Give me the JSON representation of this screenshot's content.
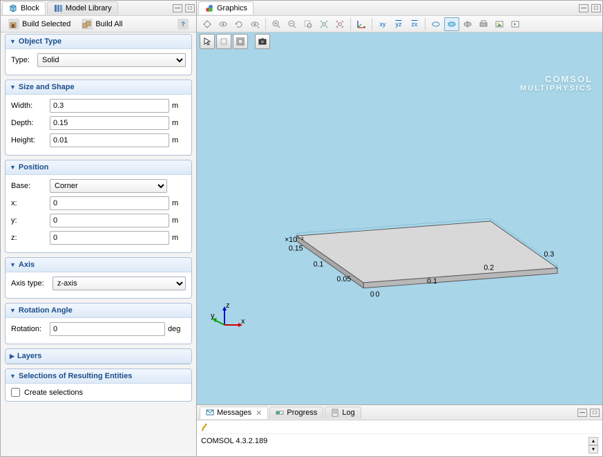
{
  "tabs": {
    "block": "Block",
    "model_library": "Model Library",
    "graphics": "Graphics"
  },
  "toolbar": {
    "build_selected": "Build Selected",
    "build_all": "Build All"
  },
  "sections": {
    "object_type": {
      "title": "Object Type",
      "type_label": "Type:",
      "type_value": "Solid"
    },
    "size_shape": {
      "title": "Size and Shape",
      "width_label": "Width:",
      "width_value": "0.3",
      "width_unit": "m",
      "depth_label": "Depth:",
      "depth_value": "0.15",
      "depth_unit": "m",
      "height_label": "Height:",
      "height_value": "0.01",
      "height_unit": "m"
    },
    "position": {
      "title": "Position",
      "base_label": "Base:",
      "base_value": "Corner",
      "x_label": "x:",
      "x_value": "0",
      "x_unit": "m",
      "y_label": "y:",
      "y_value": "0",
      "y_unit": "m",
      "z_label": "z:",
      "z_value": "0",
      "z_unit": "m"
    },
    "axis": {
      "title": "Axis",
      "axis_type_label": "Axis type:",
      "axis_type_value": "z-axis"
    },
    "rotation": {
      "title": "Rotation Angle",
      "rotation_label": "Rotation:",
      "rotation_value": "0",
      "rotation_unit": "deg"
    },
    "layers": {
      "title": "Layers"
    },
    "selections": {
      "title": "Selections of Resulting Entities",
      "create_label": "Create selections"
    }
  },
  "graphics": {
    "watermark1": "COMSOL",
    "watermark2": "MULTIPHYSICS",
    "axis_labels": {
      "x": "x",
      "y": "y",
      "z": "z"
    },
    "ticks_x": [
      "0",
      "0.1",
      "0.2",
      "0.3"
    ],
    "ticks_y": [
      "0",
      "0.05",
      "0.1",
      "0.15"
    ],
    "scale_label": "×10⁻³"
  },
  "bottom": {
    "messages": "Messages",
    "progress": "Progress",
    "log": "Log",
    "status": "COMSOL 4.3.2.189"
  },
  "chart_data": {
    "type": "3d-geometry",
    "shape": "block",
    "dimensions": {
      "width": 0.3,
      "depth": 0.15,
      "height": 0.01
    },
    "position": {
      "base": "Corner",
      "x": 0,
      "y": 0,
      "z": 0
    },
    "x_ticks": [
      0,
      0.1,
      0.2,
      0.3
    ],
    "y_ticks": [
      0,
      0.05,
      0.1,
      0.15
    ],
    "z_scale_note": "×10⁻³"
  }
}
